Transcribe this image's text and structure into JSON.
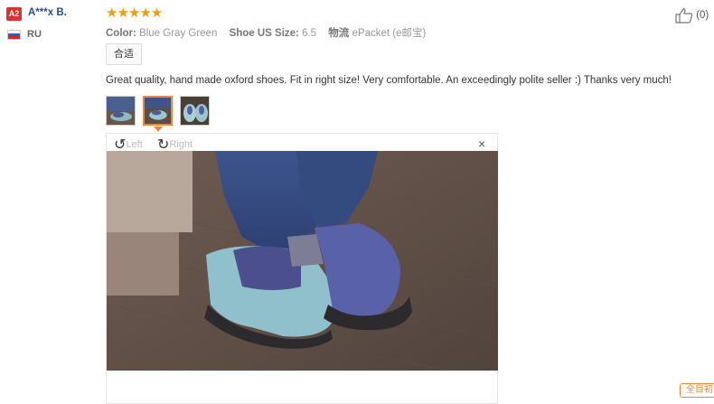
{
  "reviewer": {
    "badge": "A2",
    "name": "A***x B.",
    "country": "RU"
  },
  "rating": {
    "stars": 5,
    "stars_text": "★★★★★"
  },
  "meta": {
    "color_label": "Color:",
    "color_value": "Blue Gray Green",
    "size_label": "Shoe US Size:",
    "size_value": "6.5",
    "shipping_label": "物流",
    "shipping_value": "ePacket (e邮宝)"
  },
  "tag": "合适",
  "review_text": "Great quality, hand made oxford shoes. Fit in right size! Very comfortable. An exceedingly polite seller :) Thanks very much!",
  "viewer": {
    "rotate_left": "Left",
    "rotate_right": "Right",
    "close": "×"
  },
  "likes": {
    "count_text": "(0)"
  },
  "corner_button": "全目初",
  "colors": {
    "star": "#f39c12",
    "accent": "#e8893a",
    "badge": "#d8332c",
    "name": "#2a4d8a"
  }
}
